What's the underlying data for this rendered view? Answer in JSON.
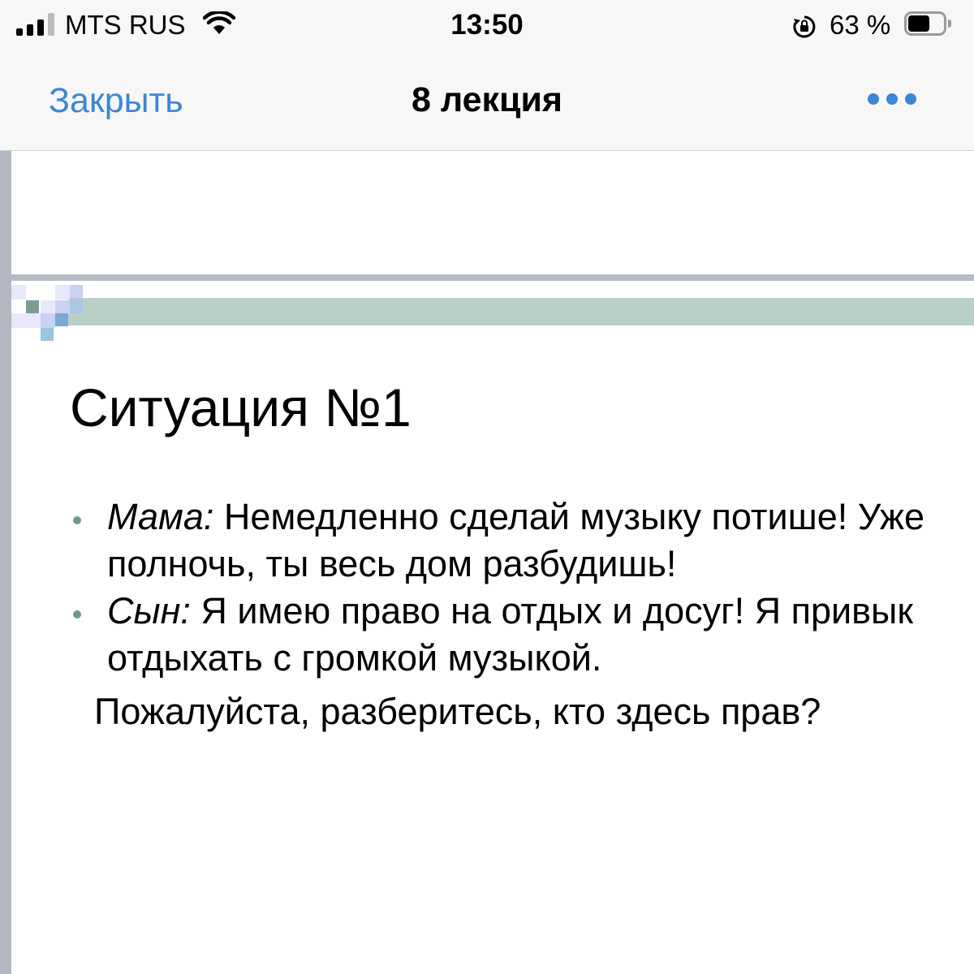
{
  "status_bar": {
    "carrier": "MTS RUS",
    "time": "13:50",
    "battery_percent_label": "63 %",
    "battery_level": 0.63,
    "signal_bars_filled": 3,
    "signal_bars_total": 4,
    "icons": [
      "signal-icon",
      "wifi-icon",
      "rotation-lock-icon",
      "battery-icon"
    ]
  },
  "nav": {
    "close_label": "Закрыть",
    "title": "8 лекция",
    "more_icon": "ellipsis-icon",
    "accent_color": "#3d86d6"
  },
  "slide": {
    "title": "Ситуация №1",
    "band_color": "#b9cfc7",
    "bullets": [
      {
        "speaker": "Мама:",
        "text": " Немедленно сделай музыку потише! Уже полночь, ты весь дом разбудишь!"
      },
      {
        "speaker": "Сын:",
        "text": " Я имею право на отдых и досуг! Я привык отдыхать с громкой музыкой."
      }
    ],
    "closing": "Пожалуйста, разберитесь, кто здесь прав?"
  }
}
